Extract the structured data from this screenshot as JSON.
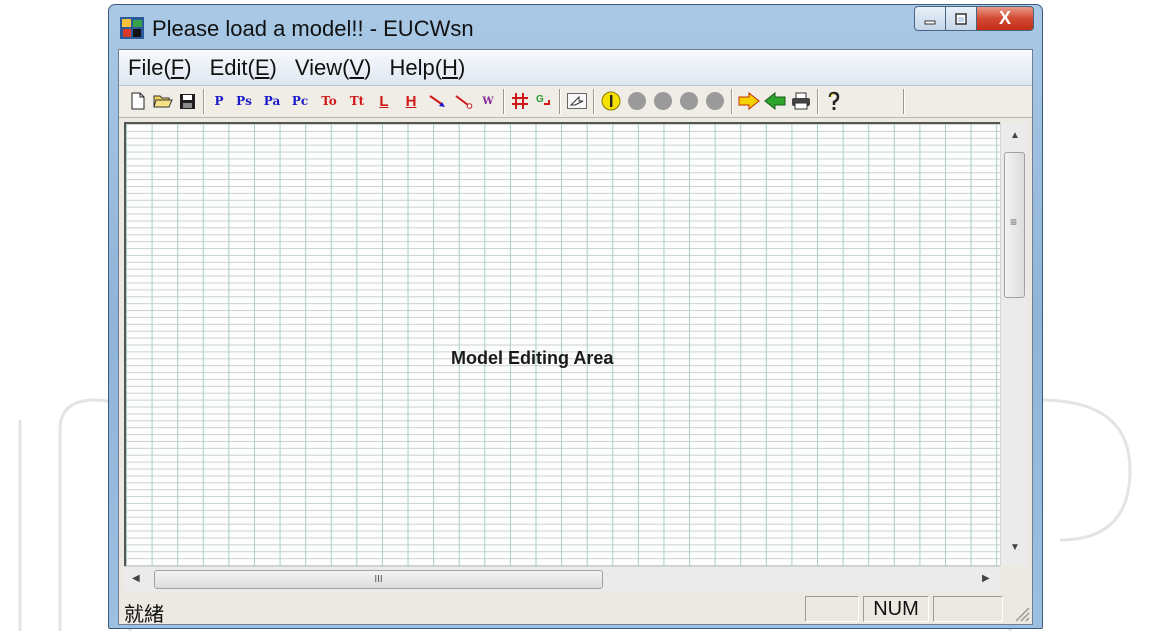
{
  "window": {
    "title": "Please load a model!! - EUCWsn"
  },
  "titlebar": {
    "icons": [
      "app-icon",
      "minimize-icon",
      "maximize-icon",
      "close-icon"
    ],
    "close_label": "X"
  },
  "menubar": {
    "items": [
      {
        "label": "File(",
        "key": "F",
        "end": ")"
      },
      {
        "label": "Edit(",
        "key": "E",
        "end": ")"
      },
      {
        "label": "View(",
        "key": "V",
        "end": ")"
      },
      {
        "label": "Help(",
        "key": "H",
        "end": ")"
      }
    ]
  },
  "toolbar": {
    "buttons": [
      {
        "name": "new-icon"
      },
      {
        "name": "open-folder-icon"
      },
      {
        "name": "save-disk-icon"
      },
      {
        "label": "P",
        "color": "#1a1ac8"
      },
      {
        "label": "Ps",
        "color": "#1a1ac8"
      },
      {
        "label": "Pa",
        "color": "#1a1ac8"
      },
      {
        "label": "Pc",
        "color": "#1a1ac8"
      },
      {
        "label": "To",
        "color": "#d01818"
      },
      {
        "label": "Tt",
        "color": "#d01818"
      },
      {
        "label": "L",
        "color": "#d01818"
      },
      {
        "label": "H",
        "color": "#d01818"
      },
      {
        "name": "arc-arrow-icon"
      },
      {
        "name": "inhibitor-arc-icon"
      },
      {
        "label": "W",
        "color": "#8a2a9a"
      },
      {
        "name": "grid-icon"
      },
      {
        "name": "goto-icon"
      },
      {
        "name": "select-pointer-icon"
      },
      {
        "name": "token-icon"
      },
      {
        "name": "run-dot-icon"
      },
      {
        "name": "step-dot-icon"
      },
      {
        "name": "pause-dot-icon"
      },
      {
        "name": "stop-dot-icon"
      },
      {
        "name": "forward-arrow-icon"
      },
      {
        "name": "back-arrow-icon"
      },
      {
        "name": "print-icon"
      },
      {
        "name": "help-icon"
      }
    ]
  },
  "editor": {
    "label": "Model Editing Area"
  },
  "scrollbars": {
    "h_thumb_grip": "III",
    "v_thumb_grip": "≡"
  },
  "statusbar": {
    "text": "就緒",
    "panels": [
      "",
      "NUM",
      ""
    ]
  },
  "colors": {
    "grid_major": "#a6cfc1",
    "grid_minor": "#c9d3cf",
    "title_gradient": "#a9c9e6",
    "close_red": "#c22d15"
  }
}
